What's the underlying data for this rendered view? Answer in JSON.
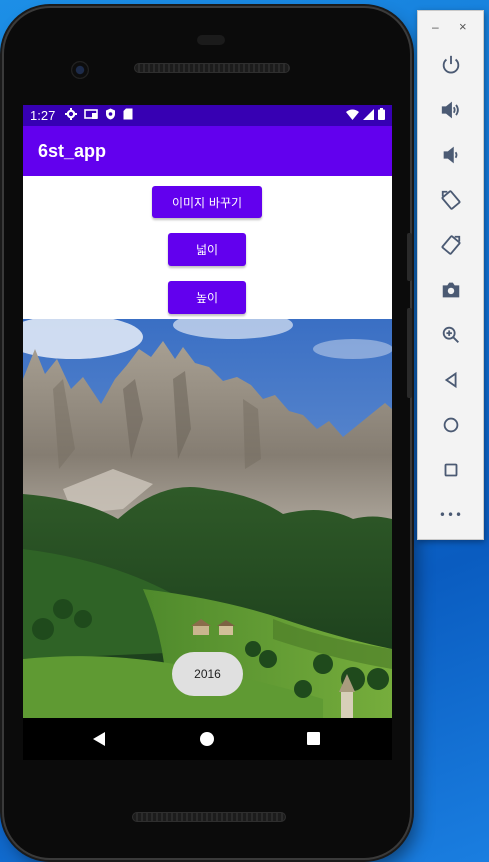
{
  "status_bar": {
    "time": "1:27"
  },
  "app_bar": {
    "title": "6st_app"
  },
  "buttons": {
    "change_image": "이미지 바꾸기",
    "width": "넓이",
    "height": "높이"
  },
  "toast": {
    "text": "2016"
  },
  "emulator_toolbar": {
    "minimize": "–",
    "close": "×",
    "more": "•••",
    "icons": [
      "power-icon",
      "volume-up-icon",
      "volume-down-icon",
      "rotate-left-icon",
      "rotate-right-icon",
      "camera-icon",
      "zoom-in-icon",
      "back-icon",
      "home-icon",
      "overview-icon",
      "more-icon"
    ]
  }
}
